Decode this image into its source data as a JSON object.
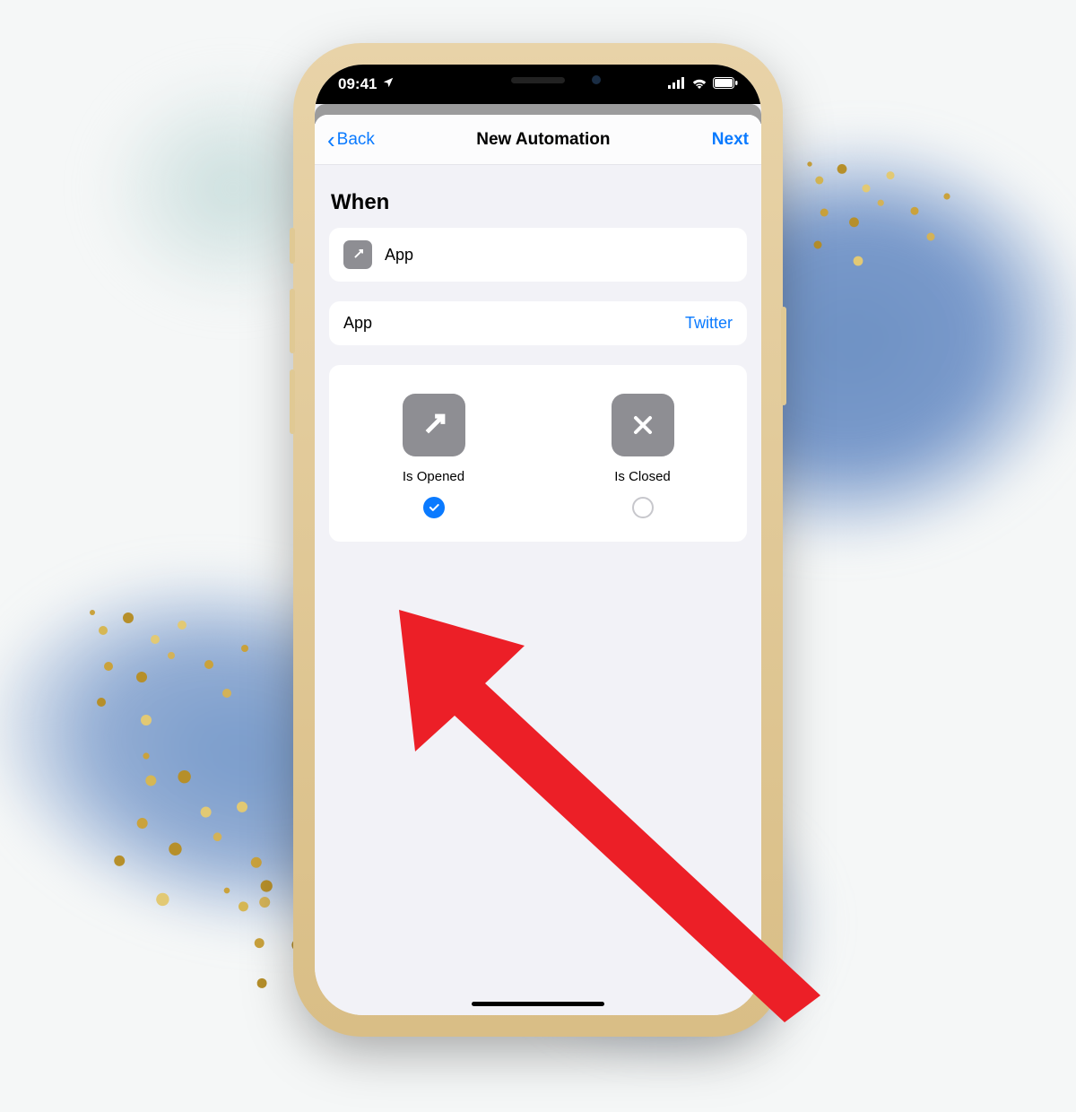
{
  "colors": {
    "accent": "#0a7aff",
    "icon_gray": "#8e8e93",
    "sheet_bg": "#f2f2f7",
    "arrow": "#ec1f27"
  },
  "statusbar": {
    "time": "09:41",
    "location_icon": "location-arrow-icon",
    "signal_icon": "cellular-icon",
    "wifi_icon": "wifi-icon",
    "battery_icon": "battery-icon"
  },
  "nav": {
    "back_label": "Back",
    "title": "New Automation",
    "next_label": "Next"
  },
  "section_title": "When",
  "trigger_row": {
    "icon": "open-arrow-icon",
    "label": "App"
  },
  "app_row": {
    "label": "App",
    "value": "Twitter"
  },
  "options": [
    {
      "id": "opened",
      "icon": "open-arrow-icon",
      "label": "Is Opened",
      "checked": true
    },
    {
      "id": "closed",
      "icon": "close-x-icon",
      "label": "Is Closed",
      "checked": false
    }
  ],
  "annotation": {
    "type": "arrow",
    "points_to": "option-opened-check"
  }
}
